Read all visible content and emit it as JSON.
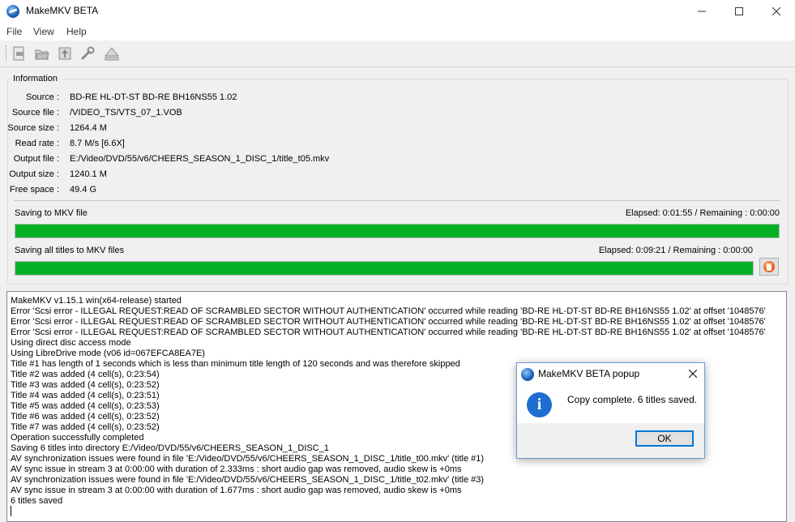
{
  "window": {
    "title": "MakeMKV BETA"
  },
  "menu": {
    "file": "File",
    "view": "View",
    "help": "Help"
  },
  "info": {
    "group_label": "Information",
    "rows": [
      {
        "label": "Source :",
        "value": "BD-RE HL-DT-ST BD-RE  BH16NS55 1.02"
      },
      {
        "label": "Source file :",
        "value": "/VIDEO_TS/VTS_07_1.VOB"
      },
      {
        "label": "Source size :",
        "value": "1264.4 M"
      },
      {
        "label": "Read rate :",
        "value": "8.7 M/s [6.6X]"
      },
      {
        "label": "Output file :",
        "value": "E:/Video/DVD/55/v6/CHEERS_SEASON_1_DISC_1/title_t05.mkv"
      },
      {
        "label": "Output size :",
        "value": "1240.1 M"
      },
      {
        "label": "Free space :",
        "value": "49.4 G"
      }
    ]
  },
  "progress": {
    "current": {
      "label": "Saving to MKV file",
      "elapsed": "Elapsed: 0:01:55 / Remaining : 0:00:00",
      "fraction": 1.0
    },
    "total": {
      "label": "Saving all titles to MKV files",
      "elapsed": "Elapsed: 0:09:21 / Remaining : 0:00:00",
      "fraction": 1.0
    }
  },
  "log": [
    "MakeMKV v1.15.1 win(x64-release) started",
    "Error 'Scsi error - ILLEGAL REQUEST:READ OF SCRAMBLED SECTOR WITHOUT AUTHENTICATION' occurred while reading 'BD-RE HL-DT-ST BD-RE BH16NS55 1.02' at offset '1048576'",
    "Error 'Scsi error - ILLEGAL REQUEST:READ OF SCRAMBLED SECTOR WITHOUT AUTHENTICATION' occurred while reading 'BD-RE HL-DT-ST BD-RE BH16NS55 1.02' at offset '1048576'",
    "Error 'Scsi error - ILLEGAL REQUEST:READ OF SCRAMBLED SECTOR WITHOUT AUTHENTICATION' occurred while reading 'BD-RE HL-DT-ST BD-RE BH16NS55 1.02' at offset '1048576'",
    "Using direct disc access mode",
    "Using LibreDrive mode (v06 id=067EFCA8EA7E)",
    "Title #1 has length of 1 seconds which is less than minimum title length of 120 seconds and was therefore skipped",
    "Title #2 was added (4 cell(s), 0:23:54)",
    "Title #3 was added (4 cell(s), 0:23:52)",
    "Title #4 was added (4 cell(s), 0:23:51)",
    "Title #5 was added (4 cell(s), 0:23:53)",
    "Title #6 was added (4 cell(s), 0:23:52)",
    "Title #7 was added (4 cell(s), 0:23:52)",
    "Operation successfully completed",
    "Saving 6 titles into directory E:/Video/DVD/55/v6/CHEERS_SEASON_1_DISC_1",
    "AV synchronization issues were found in file 'E:/Video/DVD/55/v6/CHEERS_SEASON_1_DISC_1/title_t00.mkv' (title #1)",
    "AV sync issue in stream 3 at 0:00:00 with duration of 2.333ms : short audio gap was removed, audio skew is +0ms",
    "AV synchronization issues were found in file 'E:/Video/DVD/55/v6/CHEERS_SEASON_1_DISC_1/title_t02.mkv' (title #3)",
    "AV sync issue in stream 3 at 0:00:00 with duration of 1.677ms : short audio gap was removed, audio skew is +0ms",
    "6 titles saved"
  ],
  "dialog": {
    "title": "MakeMKV BETA popup",
    "message": "Copy complete. 6 titles saved.",
    "ok": "OK"
  },
  "colors": {
    "progress_fill": "#06b025",
    "accent": "#0078d7"
  }
}
